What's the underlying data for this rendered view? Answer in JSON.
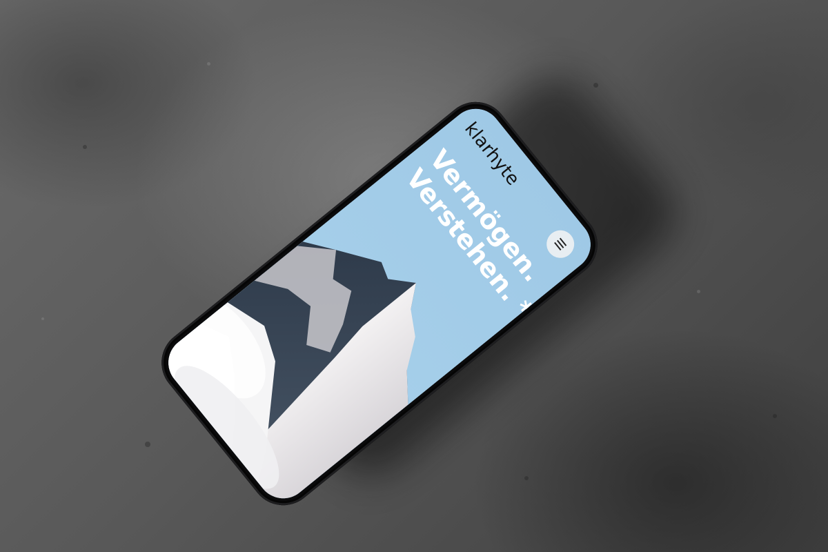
{
  "site": {
    "brand": "klarhyte",
    "headline_line1": "Vermögen.",
    "headline_line2": "Verstehen. *"
  },
  "menu": {
    "icon": "hamburger-icon"
  },
  "colors": {
    "sky": "#a7cfe9",
    "headline": "#ffffff",
    "phone_body": "#0b0b0c",
    "surface": "#5a5a5a"
  }
}
